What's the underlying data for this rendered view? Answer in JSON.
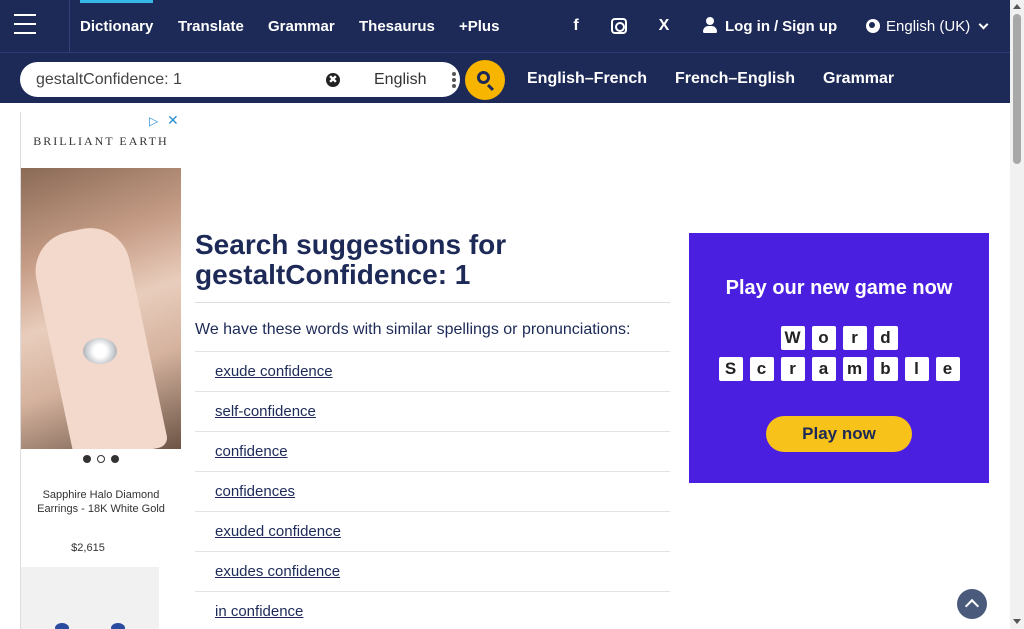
{
  "nav": {
    "items": [
      {
        "label": "Dictionary"
      },
      {
        "label": "Translate"
      },
      {
        "label": "Grammar"
      },
      {
        "label": "Thesaurus"
      },
      {
        "label": "+Plus"
      }
    ],
    "social": [
      {
        "icon": "facebook-icon",
        "glyph": "f"
      },
      {
        "icon": "instagram-icon",
        "glyph": ""
      },
      {
        "icon": "x-twitter-icon",
        "glyph": "X"
      }
    ],
    "login_label": "Log in",
    "login_sep": "/",
    "signup_label": "Sign up",
    "language": "English (UK)"
  },
  "search": {
    "value": "gestaltConfidence: 1",
    "clear_glyph": "✖",
    "dictionary": "English",
    "quick_links": [
      "English–French",
      "French–English",
      "Grammar"
    ]
  },
  "left_ad": {
    "brand": "BRILLIANT EARTH",
    "choice_glyph": "▷",
    "close_glyph": "✕",
    "product": "Sapphire Halo Diamond Earrings - 18K White Gold",
    "price": "$2,615"
  },
  "main": {
    "heading_prefix": "Search suggestions for",
    "heading_term": "gestaltConfidence: 1",
    "intro": "We have these words with similar spellings or pronunciations:",
    "suggestions": [
      "exude confidence",
      "self-confidence",
      "confidence",
      "confidences",
      "exuded confidence",
      "exudes confidence",
      "in confidence"
    ]
  },
  "right_ad": {
    "title": "Play our new game now",
    "word_row": [
      "W",
      "o",
      "r",
      "d"
    ],
    "scramble_row": [
      "S",
      "c",
      "r",
      "a",
      "m",
      "b",
      "l",
      "e"
    ],
    "button": "Play now"
  },
  "colors": {
    "navy": "#1d2a57",
    "accent_yellow": "#f7b500",
    "ad_purple": "#4a1fe0",
    "active_tab": "#35b7e8"
  }
}
